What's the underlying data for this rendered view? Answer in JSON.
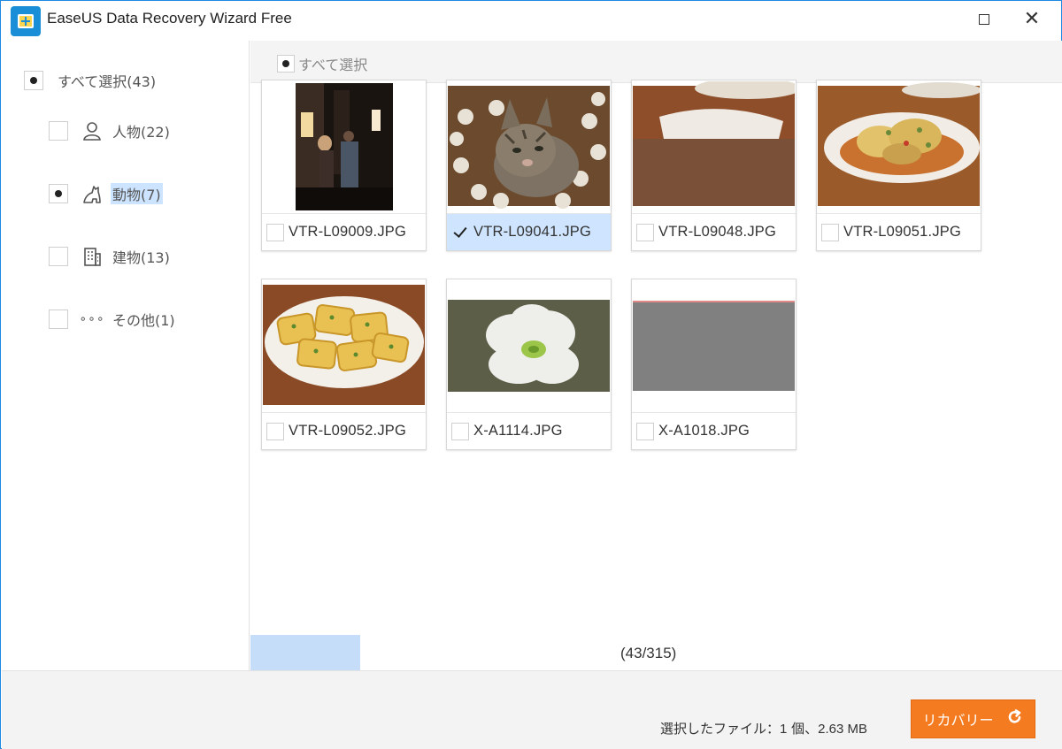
{
  "window": {
    "title": "EaseUS Data Recovery Wizard Free",
    "app_icon": "easeus-logo-icon",
    "maximize_icon": "maximize-icon",
    "close_icon": "close-icon",
    "close_glyph": "✕"
  },
  "sidebar": {
    "select_all_label": "すべて選択(43)",
    "select_all_state": "partial",
    "categories": [
      {
        "label": "人物(22)",
        "icon": "person-icon",
        "state": "unchecked",
        "selected": false
      },
      {
        "label": "動物(7)",
        "icon": "animal-icon",
        "state": "partial",
        "selected": true
      },
      {
        "label": "建物(13)",
        "icon": "building-icon",
        "state": "unchecked",
        "selected": false
      },
      {
        "label": "その他(1)",
        "icon": "more-dots-icon",
        "icon_glyph": "∘∘∘",
        "state": "unchecked",
        "selected": false
      }
    ]
  },
  "main": {
    "select_all_label": "すべて選択",
    "select_all_state": "partial",
    "files": [
      {
        "name": "VTR-L09009.JPG",
        "checked": false,
        "thumb": "night-street-photo"
      },
      {
        "name": "VTR-L09041.JPG",
        "checked": true,
        "thumb": "cat-photo"
      },
      {
        "name": "VTR-L09048.JPG",
        "checked": false,
        "thumb": "partial-food-photo"
      },
      {
        "name": "VTR-L09051.JPG",
        "checked": false,
        "thumb": "fried-food-photo"
      },
      {
        "name": "VTR-L09052.JPG",
        "checked": false,
        "thumb": "omelette-photo"
      },
      {
        "name": "X-A1114.JPG",
        "checked": false,
        "thumb": "white-flower-photo"
      },
      {
        "name": "X-A1018.JPG",
        "checked": false,
        "thumb": "gray-corrupted-photo"
      }
    ],
    "counter": "(43/315)"
  },
  "footer": {
    "status_prefix": "選択したファイル：",
    "status_count": "1",
    "status_unit": " 個、",
    "status_size": "2.63 MB",
    "recover_label": "リカバリー",
    "recover_icon": "refresh-icon"
  },
  "colors": {
    "accent": "#f47b20",
    "selection": "#cfe5ff",
    "window_border": "#1e88e5"
  }
}
